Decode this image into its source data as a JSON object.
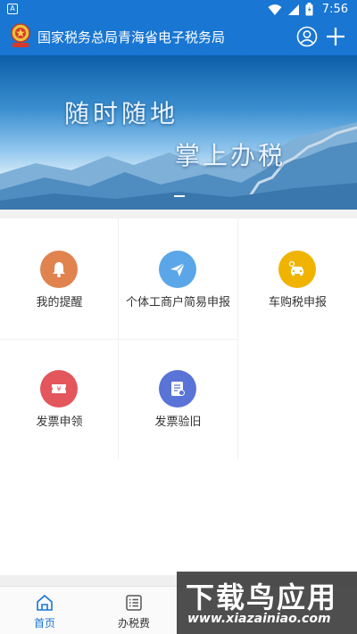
{
  "status_bar": {
    "time": "7:56",
    "notification_icon": "A"
  },
  "header": {
    "title": "国家税务总局青海省电子税务局",
    "bg_color": "#1976d2"
  },
  "banner": {
    "line1": "随时随地",
    "line2": "掌上办税"
  },
  "tiles": [
    {
      "label": "我的提醒",
      "icon": "bell-icon",
      "color": "#e0834f"
    },
    {
      "label": "个体工商户简易申报",
      "icon": "paper-plane-icon",
      "color": "#5aa6e8"
    },
    {
      "label": "车购税申报",
      "icon": "car-icon",
      "color": "#f0b400"
    },
    {
      "label": "发票申领",
      "icon": "ticket-icon",
      "color": "#e3565b"
    },
    {
      "label": "发票验旧",
      "icon": "invoice-check-icon",
      "color": "#5a73d6"
    }
  ],
  "tabbar": {
    "tabs": [
      {
        "label": "首页",
        "icon": "home-icon",
        "active": true
      },
      {
        "label": "办税费",
        "icon": "list-icon",
        "active": false
      }
    ],
    "active_color": "#1976d2",
    "inactive_color": "#333333"
  },
  "watermark": {
    "title": "下载鸟应用",
    "url": "www.xiazainiao.com"
  }
}
